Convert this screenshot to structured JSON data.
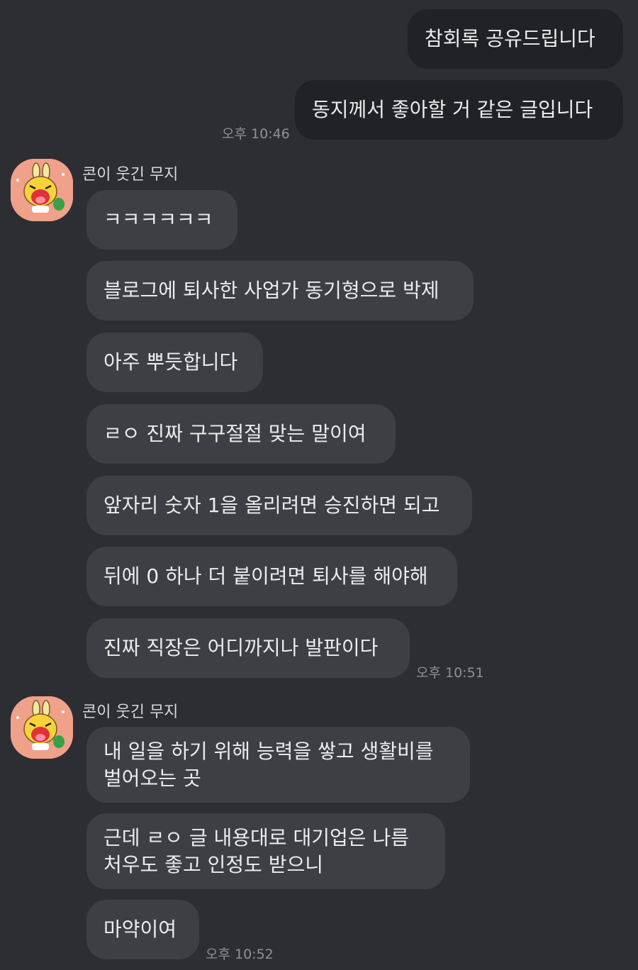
{
  "chat": {
    "outgoing": {
      "messages": [
        "참회록 공유드립니다",
        "동지께서 좋아할 거 같은 글입니다"
      ],
      "time": "오후 10:46"
    },
    "group1": {
      "sender": "콘이 웃긴 무지",
      "messages": [
        "ㅋㅋㅋㅋㅋㅋ",
        "블로그에 퇴사한 사업가 동기형으로 박제",
        "아주 뿌듯합니다",
        "ㄹㅇ 진짜 구구절절 맞는 말이여",
        "앞자리 숫자 1을 올리려면 승진하면 되고",
        "뒤에 0 하나 더 붙이려면 퇴사를 해야해",
        "진짜 직장은 어디까지나 발판이다"
      ],
      "time": "오후 10:51"
    },
    "group2": {
      "sender": "콘이 웃긴 무지",
      "messages": [
        [
          "내 일을 하기 위해 능력을 쌓고 생활비를",
          "벌어오는 곳"
        ],
        [
          "근데 ㄹㅇ 글 내용대로 대기업은 나름",
          "처우도 좋고 인정도 받으니"
        ],
        "마약이여"
      ],
      "time": "오후 10:52"
    }
  }
}
